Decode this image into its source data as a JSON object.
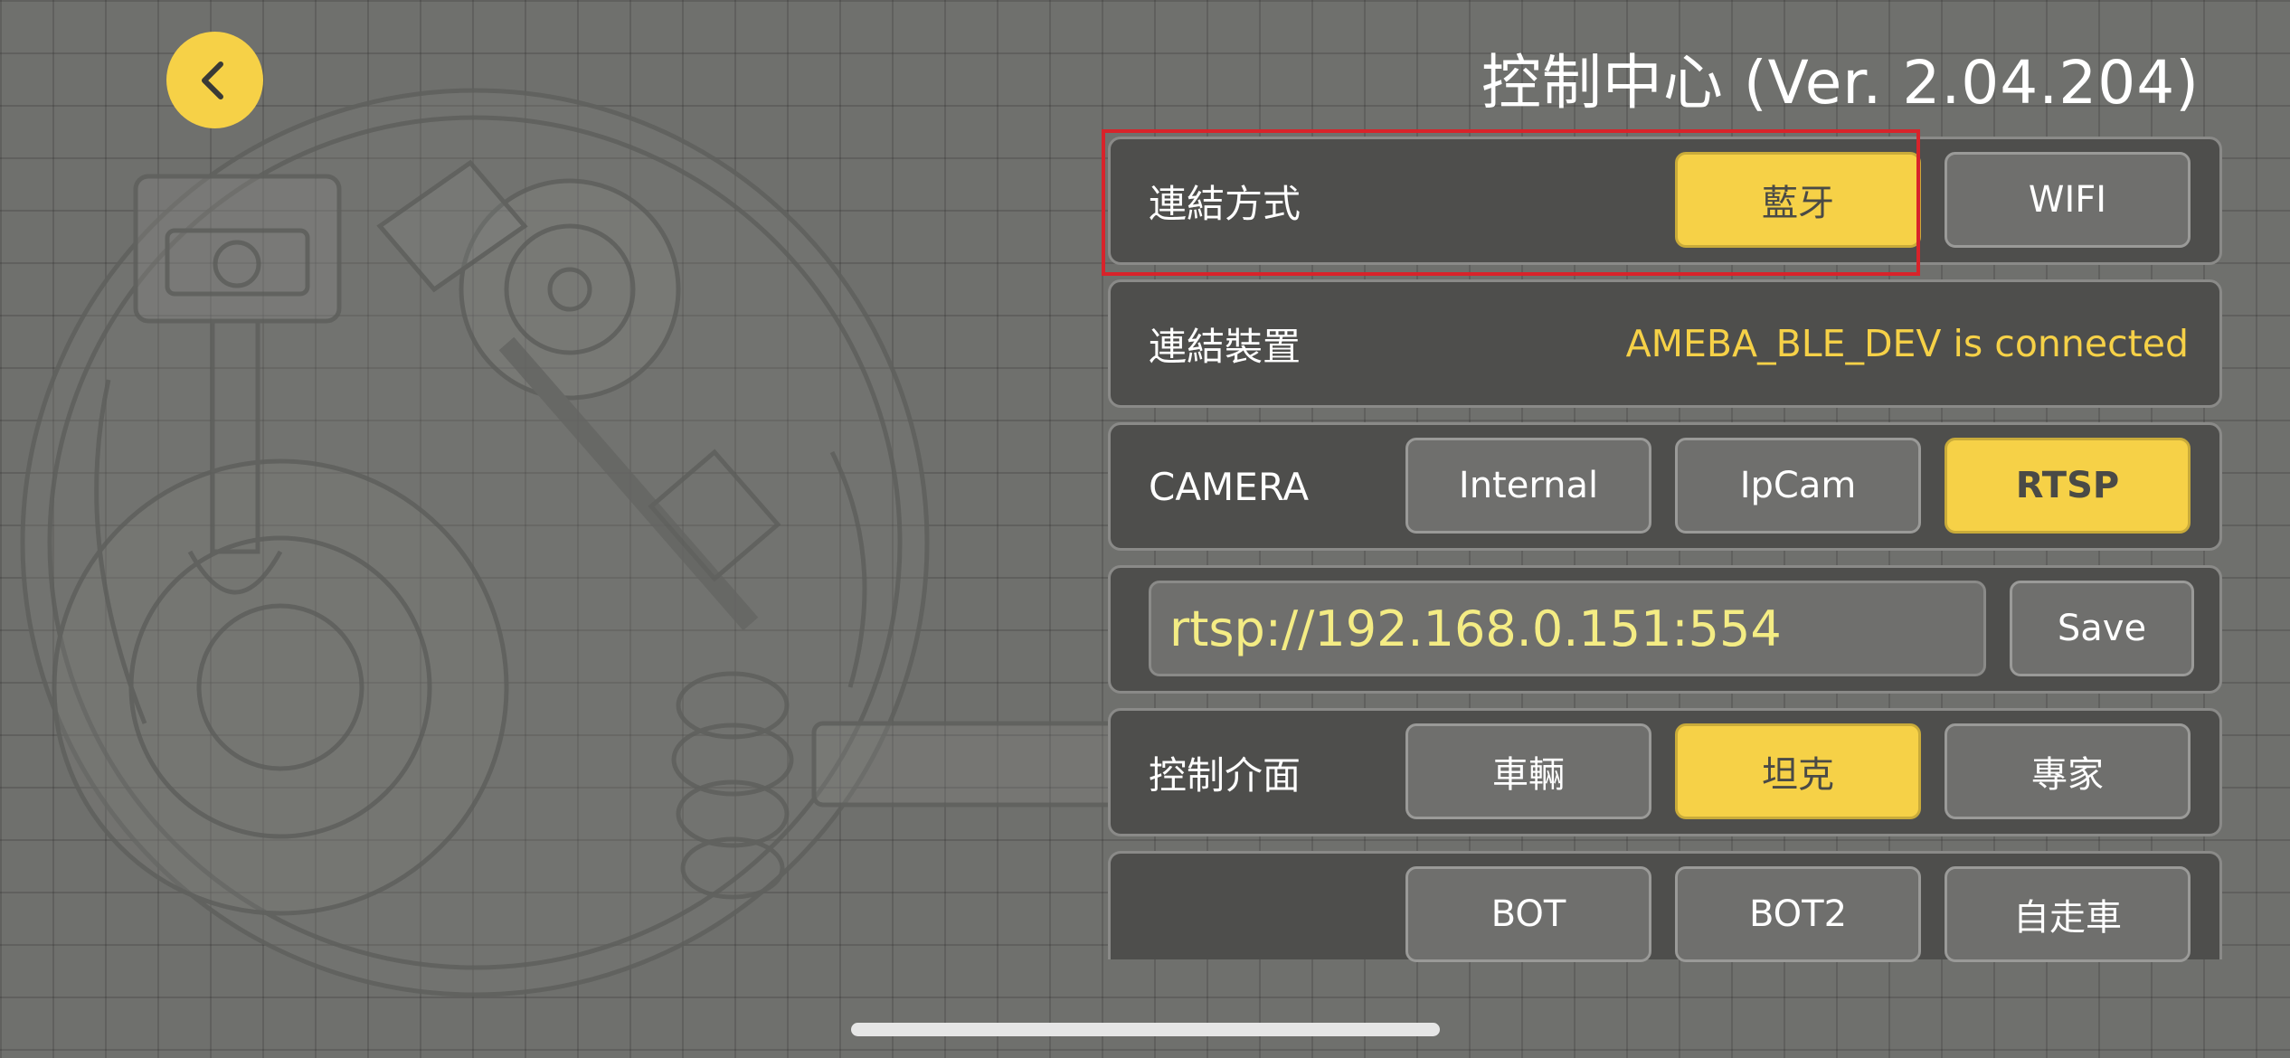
{
  "header": {
    "title": "控制中心 (Ver. 2.04.204)",
    "back_icon": "chevron-left-icon"
  },
  "connection": {
    "label": "連結方式",
    "options": [
      "藍牙",
      "WIFI"
    ],
    "selected": "藍牙"
  },
  "device": {
    "label": "連結裝置",
    "status": "AMEBA_BLE_DEV is connected"
  },
  "camera": {
    "label": "CAMERA",
    "options": [
      "Internal",
      "IpCam",
      "RTSP"
    ],
    "selected": "RTSP"
  },
  "rtsp": {
    "url": "rtsp://192.168.0.151:554",
    "save_label": "Save"
  },
  "control": {
    "label": "控制介面",
    "options": [
      "車輛",
      "坦克",
      "專家"
    ],
    "selected": "坦克"
  },
  "control_extra": {
    "options": [
      "BOT",
      "BOT2",
      "自走車"
    ]
  },
  "colors": {
    "accent": "#f6d147",
    "background": "#6f706d",
    "panel": "#4e4e4c",
    "highlight": "#d8232a",
    "url_text": "#f4ec84"
  }
}
